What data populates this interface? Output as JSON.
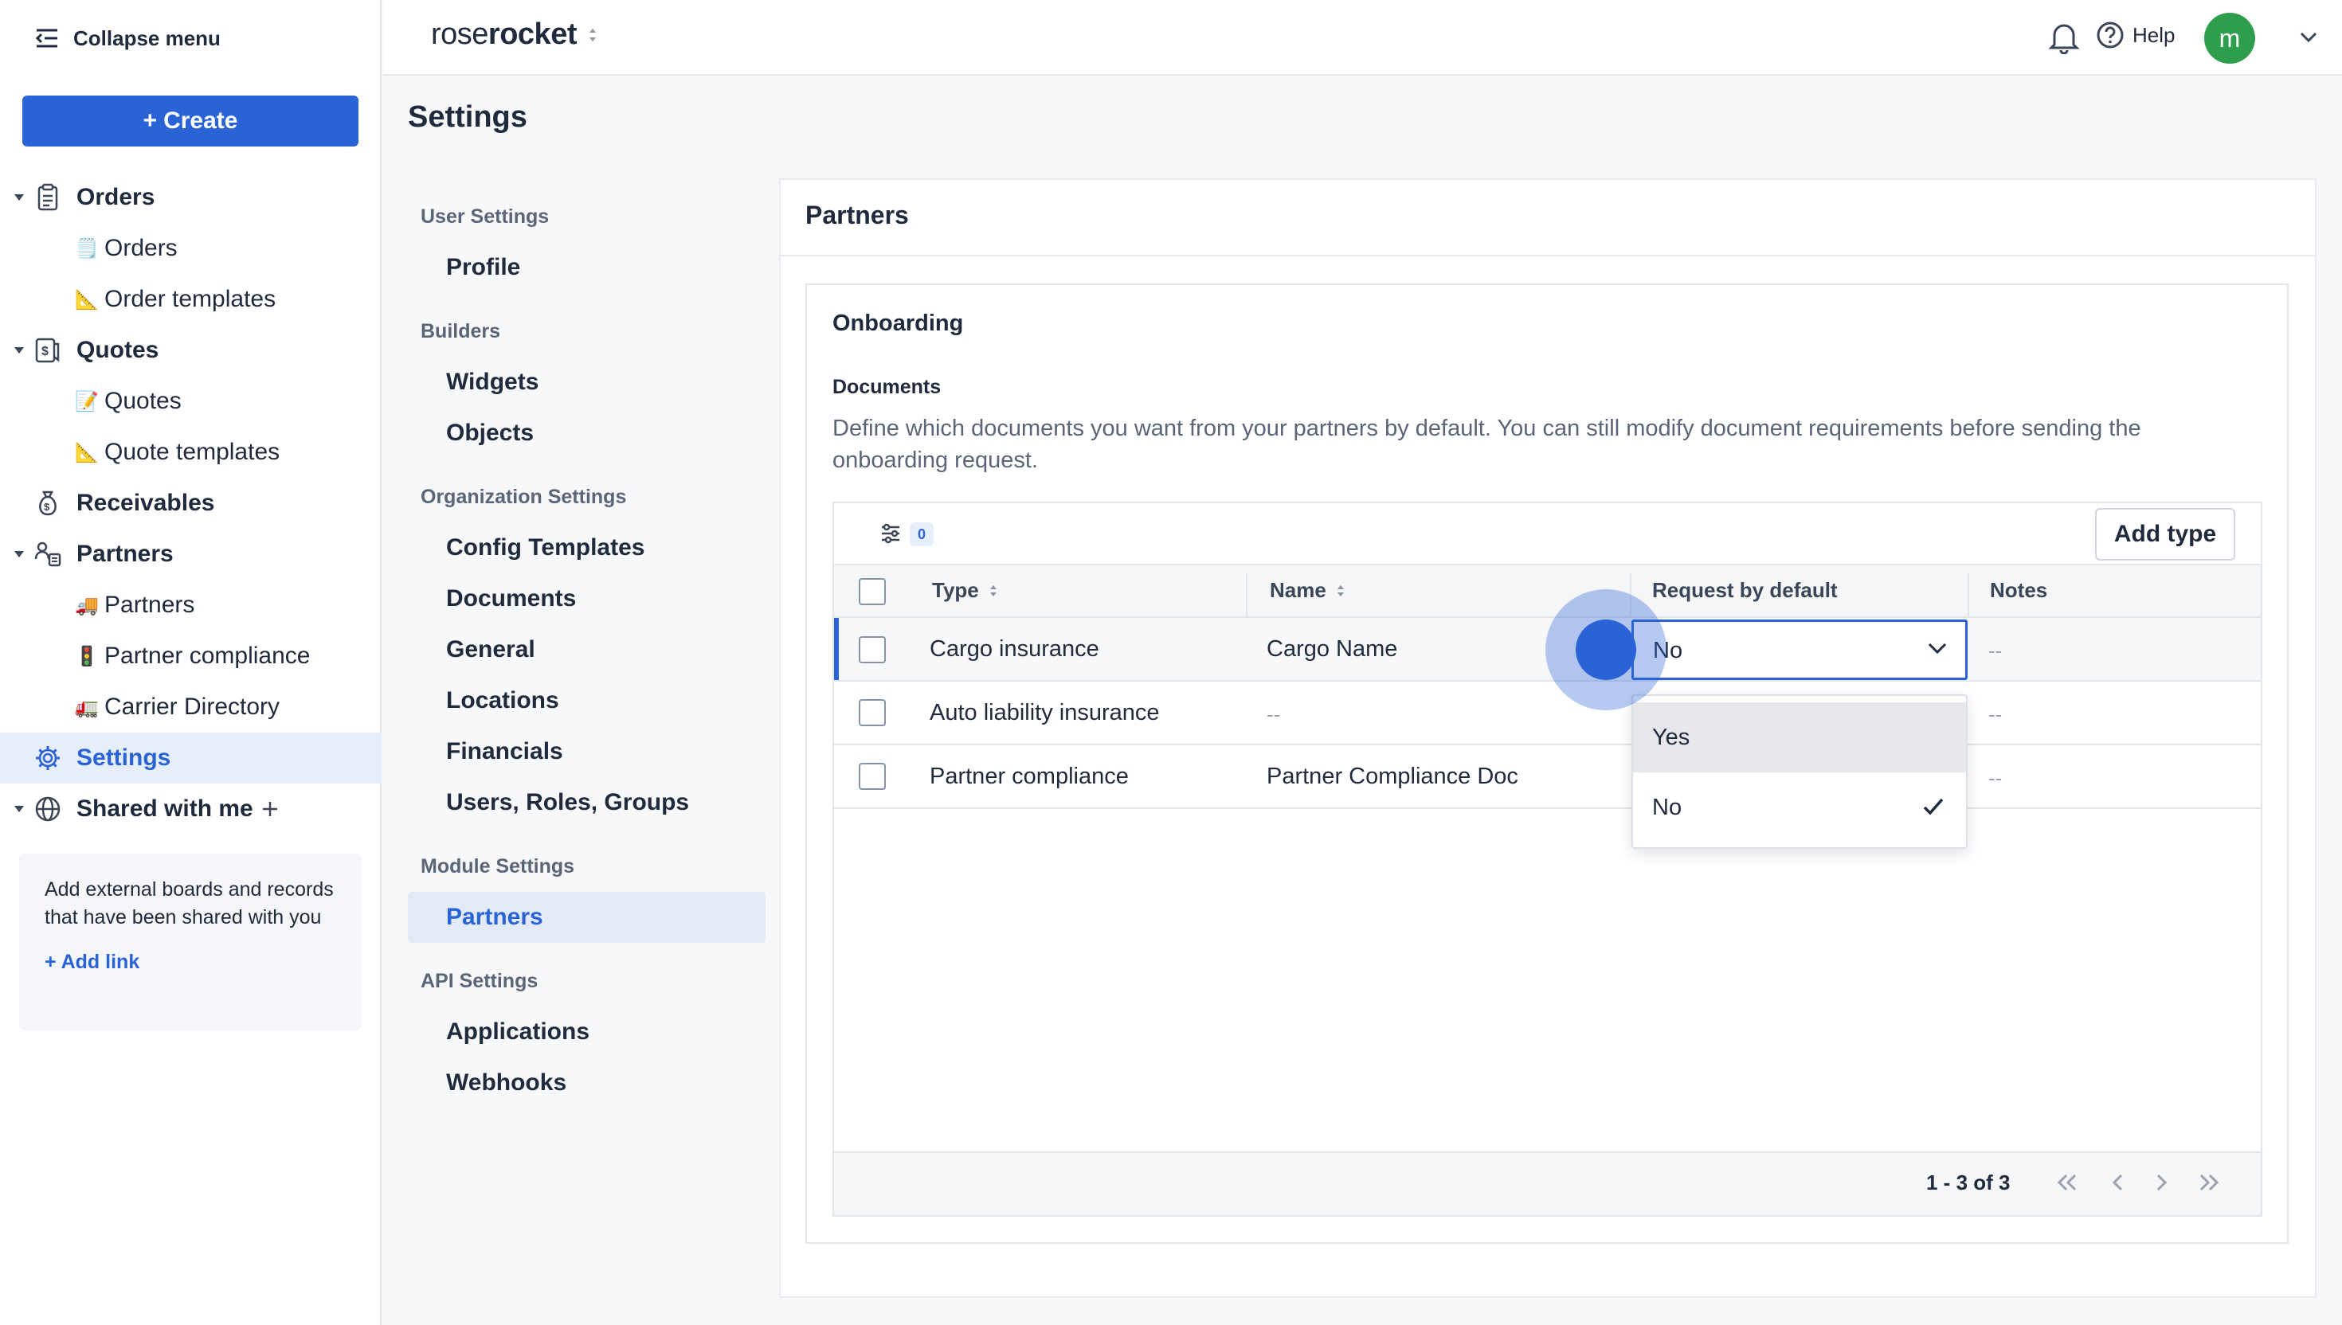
{
  "sidebar": {
    "collapse_label": "Collapse menu",
    "create_label": "Create",
    "orders": {
      "label": "Orders",
      "children": [
        {
          "emoji": "🗒️",
          "label": "Orders"
        },
        {
          "emoji": "📐",
          "label": "Order templates"
        }
      ]
    },
    "quotes": {
      "label": "Quotes",
      "children": [
        {
          "emoji": "📝",
          "label": "Quotes"
        },
        {
          "emoji": "📐",
          "label": "Quote templates"
        }
      ]
    },
    "receivables": {
      "label": "Receivables"
    },
    "partners": {
      "label": "Partners",
      "children": [
        {
          "emoji": "🚚",
          "label": "Partners"
        },
        {
          "emoji": "🚦",
          "label": "Partner compliance"
        },
        {
          "emoji": "🚛",
          "label": "Carrier Directory"
        }
      ]
    },
    "settings": {
      "label": "Settings"
    },
    "shared": {
      "label": "Shared with me"
    },
    "share_box": {
      "text": "Add external boards and records that have been shared with you",
      "link": "Add link"
    }
  },
  "topbar": {
    "logo_light": "rose",
    "logo_bold": "rocket",
    "help_label": "Help",
    "avatar_initial": "m"
  },
  "settings_nav": {
    "title": "Settings",
    "sections": [
      {
        "heading": "User Settings",
        "items": [
          "Profile"
        ]
      },
      {
        "heading": "Builders",
        "items": [
          "Widgets",
          "Objects"
        ]
      },
      {
        "heading": "Organization Settings",
        "items": [
          "Config Templates",
          "Documents",
          "General",
          "Locations",
          "Financials",
          "Users, Roles, Groups"
        ]
      },
      {
        "heading": "Module Settings",
        "items": [
          "Partners"
        ]
      },
      {
        "heading": "API Settings",
        "items": [
          "Applications",
          "Webhooks"
        ]
      }
    ],
    "active_item": "Partners"
  },
  "main": {
    "title": "Partners",
    "section": "Onboarding",
    "docs_heading": "Documents",
    "docs_description": "Define which documents you want from your partners by default. You can still modify document requirements before sending the onboarding request.",
    "filter_count": "0",
    "add_type_label": "Add type",
    "columns": [
      "Type",
      "Name",
      "Request by default",
      "Notes"
    ],
    "rows": [
      {
        "type": "Cargo insurance",
        "name": "Cargo Name",
        "request": "No",
        "notes": "--"
      },
      {
        "type": "Auto liability insurance",
        "name": "--",
        "request": "",
        "notes": "--"
      },
      {
        "type": "Partner compliance",
        "name": "Partner Compliance Doc",
        "request": "",
        "notes": "--"
      }
    ],
    "dropdown": {
      "current": "No",
      "options": [
        "Yes",
        "No"
      ],
      "selected": "No",
      "hovered": "Yes"
    },
    "pagination": "1 - 3 of 3"
  },
  "colors": {
    "accent": "#2a63d6",
    "avatar": "#2e9e4d",
    "active_bg": "#e3eaf7"
  }
}
